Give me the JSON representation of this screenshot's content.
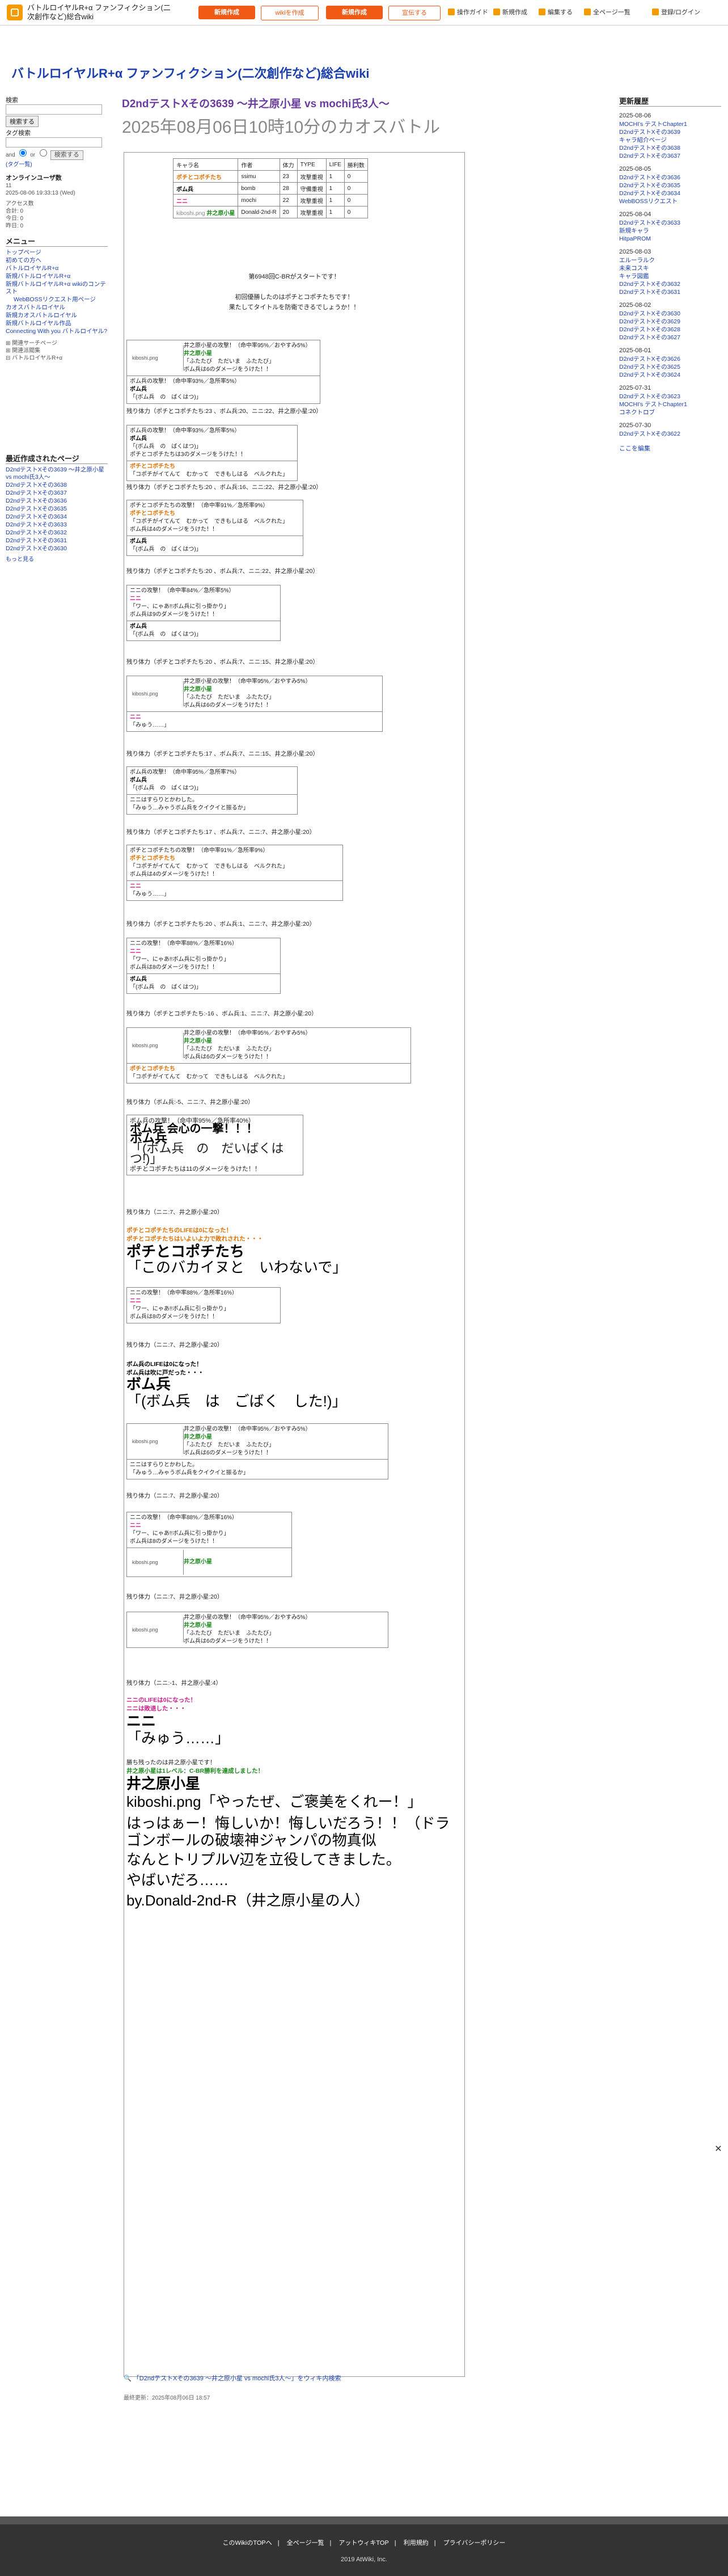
{
  "site": {
    "name": "バトルロイヤルR+α ファンフィクション(二次創作など)総合wiki",
    "title": "バトルロイヤルR+α ファンフィクション(二次創作など)総合wiki"
  },
  "topnav": {
    "btn1": "新規作成",
    "btn2": "wikiを作成",
    "btn3": "新規作成",
    "btn4": "宣伝する",
    "links": [
      "操作ガイド",
      "新規作成",
      "編集する",
      "全ページ一覧",
      "登録/ログイン"
    ]
  },
  "left": {
    "search_label": "検索",
    "search_btn": "検索する",
    "tag_label": "タグ検索",
    "and": "and",
    "or": "or",
    "tag_btn": "検索する",
    "tag_list": "(タグ一覧)",
    "online_label": "オンラインユーザ数",
    "online_value": "11",
    "timestamp": "2025-08-06 19:33:13 (Wed)",
    "access_label": "アクセス数",
    "total": "合計: 0",
    "today": "今日: 0",
    "yesterday": "昨日: 0",
    "menu_title": "メニュー",
    "menu": [
      "トップページ",
      "初めての方へ",
      "バトルロイヤルR+α",
      "新規バトルロイヤルR+α",
      "新規バトルロイヤルR+α wikiのコンテスト",
      "WebBOSSリクエスト用ページ",
      "カオスバトルロイヤル",
      "新規カオスバトルロイヤル",
      "新規バトルロイヤル作品",
      "Connecting With you バトルロイヤル?"
    ],
    "sub1": "関連サーチページ",
    "sub2": "関連派閥集",
    "sub3": "バトルロイヤルR+α",
    "recent_title": "最近作成されたページ",
    "recent": [
      "D2ndテストXその3639 〜井之原小星 vs mochi氏3人〜",
      "D2ndテストXその3638",
      "D2ndテストXその3637",
      "D2ndテストXその3636",
      "D2ndテストXその3635",
      "D2ndテストXその3634",
      "D2ndテストXその3633",
      "D2ndテストXその3632",
      "D2ndテストXその3631",
      "D2ndテストXその3630"
    ],
    "more": "もっと見る"
  },
  "right": {
    "title": "更新履歴",
    "groups": [
      {
        "date": "2025-08-06",
        "items": [
          "MOCHI's テストChapter1",
          "D2ndテストXその3639",
          "キャラ紹介ページ",
          "D2ndテストXその3638",
          "D2ndテストXその3637"
        ]
      },
      {
        "date": "2025-08-05",
        "items": [
          "D2ndテストXその3636",
          "D2ndテストXその3635",
          "D2ndテストXその3634",
          "WebBOSSリクエスト"
        ]
      },
      {
        "date": "2025-08-04",
        "items": [
          "D2ndテストXその3633",
          "新規キャラ",
          "HitpaPROM"
        ]
      },
      {
        "date": "2025-08-03",
        "items": [
          "エルーラルク",
          "未来コスキ",
          "キャラ図鑑",
          "D2ndテストXその3632",
          "D2ndテストXその3631"
        ]
      },
      {
        "date": "2025-08-02",
        "items": [
          "D2ndテストXその3630",
          "D2ndテストXその3629",
          "D2ndテストXその3628",
          "D2ndテストXその3627"
        ]
      },
      {
        "date": "2025-08-01",
        "items": [
          "D2ndテストXその3626",
          "D2ndテストXその3625",
          "D2ndテストXその3624"
        ]
      },
      {
        "date": "2025-07-31",
        "items": [
          "D2ndテストXその3623",
          "MOCHI's テストChapter1",
          "コネクトロブ"
        ]
      },
      {
        "date": "2025-07-30",
        "items": [
          "D2ndテストXその3622"
        ]
      }
    ],
    "more": "ここを編集"
  },
  "main": {
    "title": "D2ndテストXその3639 〜井之原小星 vs mochi氏3人〜",
    "subtitle": "2025年08月06日10時10分のカオスバトル"
  },
  "table": {
    "headers": [
      "キャラ名",
      "作者",
      "体力",
      "TYPE",
      "LIFE",
      "勝利数"
    ],
    "rows": [
      [
        "ポチとコポチたち",
        "ssimu",
        "23",
        "攻撃重視",
        "1",
        "0"
      ],
      [
        "ボム兵",
        "bomb",
        "28",
        "守備重視",
        "1",
        "0"
      ],
      [
        "ニニ",
        "mochi",
        "22",
        "攻撃重視",
        "1",
        "0"
      ],
      [
        "井之原小星",
        "Donald-2nd-R",
        "20",
        "攻撃重視",
        "1",
        "0"
      ]
    ],
    "image_label": "kiboshi.png"
  },
  "intro": {
    "line1": "第6948回C-BRがスタートです！",
    "line2": "初回優勝したのはポチとコポチたちです！",
    "line3": "果たしてタイトルを防衛できるでしょうか！！"
  },
  "log": [
    "残り体力（ポチとコポチたち:23 、ボム兵:20、ニニ:22、井之原小星:20）",
    "残り体力（ポチとコポチたち:20 、ボム兵:16、ニニ:22、井之原小星:20）",
    "残り体力（ポチとコポチたち:20 、ボム兵:7、ニニ:22、井之原小星:20）",
    "残り体力（ポチとコポチたち:20 、ボム兵:7、ニニ:15、井之原小星:20）",
    "残り体力（ポチとコポチたち:17 、ボム兵:7、ニニ:15、井之原小星:20）",
    "残り体力（ポチとコポチたち:17 、ボム兵:7、ニニ:7、井之原小星:20）",
    "残り体力（ポチとコポチたち:20 、ボム兵:1、ニニ:7、井之原小星:20）",
    "残り体力（ポチとコポチたち:-16 、ボム兵:1、ニニ:7、井之原小星:20）",
    "残り体力（ボム兵:-5、ニニ:7、井之原小星:20）",
    "残り体力（ニニ:7、井之原小星:20）",
    "残り体力（ニニ:7、井之原小星:20）",
    "残り体力（ニニ:-1、井之原小星:4）"
  ],
  "boxes": {
    "b1": [
      "井之原小星の攻撃！（命中率95%／おやすみ5%）",
      "井之原小星",
      "「ふたたび　ただいま　ふたたび」",
      "ボム兵は6のダメージをうけた！！"
    ],
    "b2": [
      "ボム兵の攻撃！（命中率93%／急所率5%）",
      "ボム兵",
      "「(ボム兵　の　ばくはつ)」",
      "ポチとコポチたちは3のダメージをうけた！！"
    ],
    "b3": [
      "ポチとコポチたちの攻撃！（命中率91%／急所率9%）",
      "ポチとコポチたち",
      "「コポチがイてんて　むかって　できもしはる　ベルクれた」",
      "ボム兵は4のダメージをうけた！！"
    ],
    "b4": [
      "ニニの攻撃！（命中率84%／急所率5%）",
      "ニニ",
      "「ワー、にゃあ!!ボム兵に引っ掛かり」",
      "ボム兵は9のダメージをうけた！！"
    ],
    "b5": [
      "ボム兵の攻撃！（命中率95%／急所率7%）",
      "ニニはすらりとかわした。",
      "「みゅう…みゃうボム兵をクイクイと振るか」"
    ],
    "b6": [
      "ニニの攻撃！（命中率88%／急所率16%）",
      "ニニ",
      "「ワー、にゃあ!!ボム兵に引っ掛かり」",
      "ボム兵は8のダメージをうけた！！"
    ],
    "b7": [
      "ボム兵の攻撃！（命中率95%／急所率40%）",
      "ボム兵 会心の一撃！！！",
      "「(ボム兵　の　だいばくはつ!)」",
      "ポチとコポチたちは11のダメージをうけた！！"
    ]
  },
  "bigtext": {
    "t1": "ポチとコポチたち",
    "t2": "「このバカイヌと　いわないで」",
    "t3": "ボム兵",
    "t4": "「(ボム兵　は　ごばく　した!)」",
    "t5": "「みゅう……」",
    "t6": "井之原小星",
    "t7": "kiboshi.png「やったぜ、ご褒美をくれー！」",
    "t8": "はっはぁー！悔しいか！悔しいだろう！！（ドラゴンボールの破壊神ジャンパの物真似",
    "t9": "なんとトリプルV辺を立役してきました。",
    "t10": "やばいだろ……",
    "t11": "by.Donald-2nd-R（井之原小星の人）"
  },
  "small_notes": {
    "n1": "ポチとコポチたちのLIFEは0になった！",
    "n2": "ポチとコポチたちはいよいよ力で敗れされた・・・",
    "n3": "ボム兵のLIFEは0になった！",
    "n4": "ボム兵は吹に戸だった・・・",
    "n5": "ニニのLIFEは0になった！",
    "n6": "ニニは敗退した・・・",
    "n7": "勝ち残ったのは井之原小星です！",
    "n8": "井之原小星は1レベル：C-BR勝利を達成しました！"
  },
  "bottom": {
    "link": "「D2ndテストXその3639 〜井之原小星 vs mochi氏3人〜」をウィキ内検索",
    "updated": "最終更新：2025年08月06日 18:57"
  },
  "footer": {
    "links": [
      "このWikiのTOPへ",
      "全ページ一覧",
      "アットウィキTOP",
      "利用規約",
      "プライバシーポリシー"
    ],
    "copy": "2019 AtWiki, Inc."
  }
}
